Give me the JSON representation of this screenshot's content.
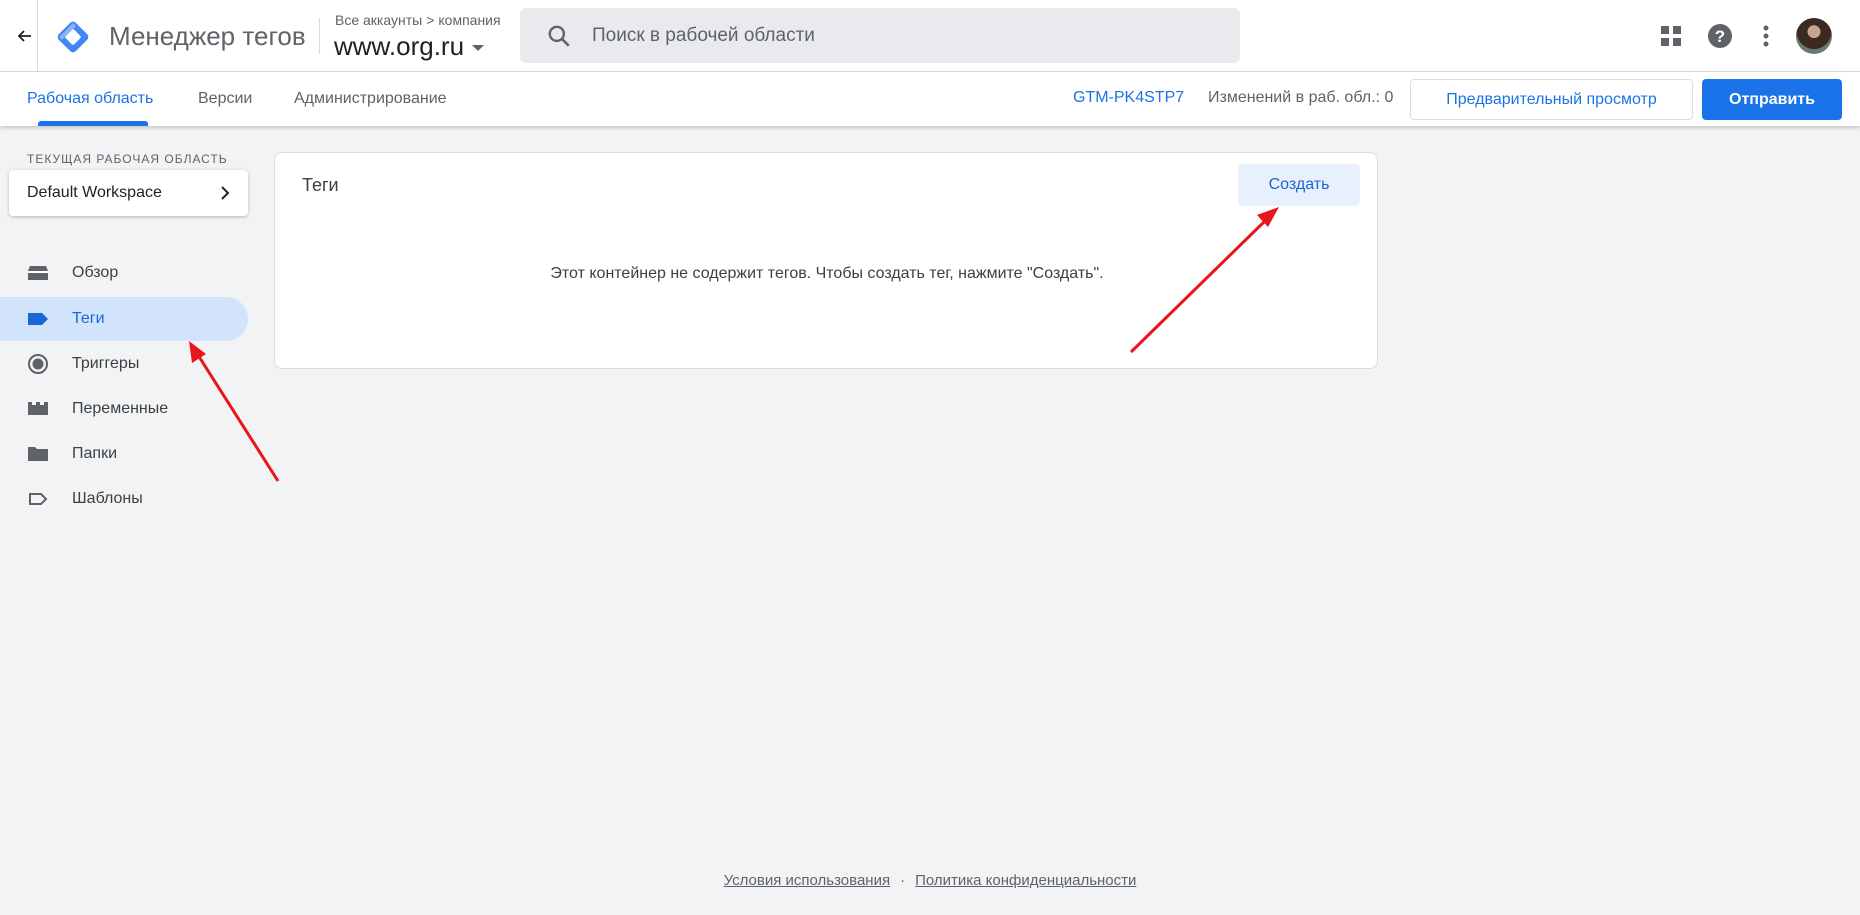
{
  "header": {
    "app_title": "Менеджер тегов",
    "breadcrumb_accounts": "Все аккаунты",
    "breadcrumb_sep": ">",
    "breadcrumb_account": "компания",
    "container_name": "www.org.ru",
    "search_placeholder": "Поиск в рабочей области"
  },
  "subnav": {
    "tabs": [
      {
        "label": "Рабочая область",
        "active": true
      },
      {
        "label": "Версии",
        "active": false
      },
      {
        "label": "Администрирование",
        "active": false
      }
    ],
    "container_id": "GTM-PK4STP7",
    "changes_label": "Изменений в раб. обл.: 0",
    "preview_label": "Предварительный просмотр",
    "submit_label": "Отправить"
  },
  "sidebar": {
    "workspace_caption": "ТЕКУЩАЯ РАБОЧАЯ ОБЛАСТЬ",
    "workspace_name": "Default Workspace",
    "items": [
      {
        "label": "Обзор",
        "icon": "overview-icon",
        "active": false
      },
      {
        "label": "Теги",
        "icon": "tag-icon",
        "active": true
      },
      {
        "label": "Триггеры",
        "icon": "trigger-icon",
        "active": false
      },
      {
        "label": "Переменные",
        "icon": "variables-icon",
        "active": false
      },
      {
        "label": "Папки",
        "icon": "folder-icon",
        "active": false
      },
      {
        "label": "Шаблоны",
        "icon": "template-icon",
        "active": false
      }
    ]
  },
  "main": {
    "title": "Теги",
    "create_label": "Создать",
    "empty_message": "Этот контейнер не содержит тегов. Чтобы создать тег, нажмите \"Создать\"."
  },
  "footer": {
    "terms": "Условия использования",
    "separator": "·",
    "privacy": "Политика конфиденциальности"
  },
  "colors": {
    "accent": "#1a73e8",
    "active_nav_bg": "#d2e3fc",
    "annotation_arrow": "#e8151b"
  }
}
